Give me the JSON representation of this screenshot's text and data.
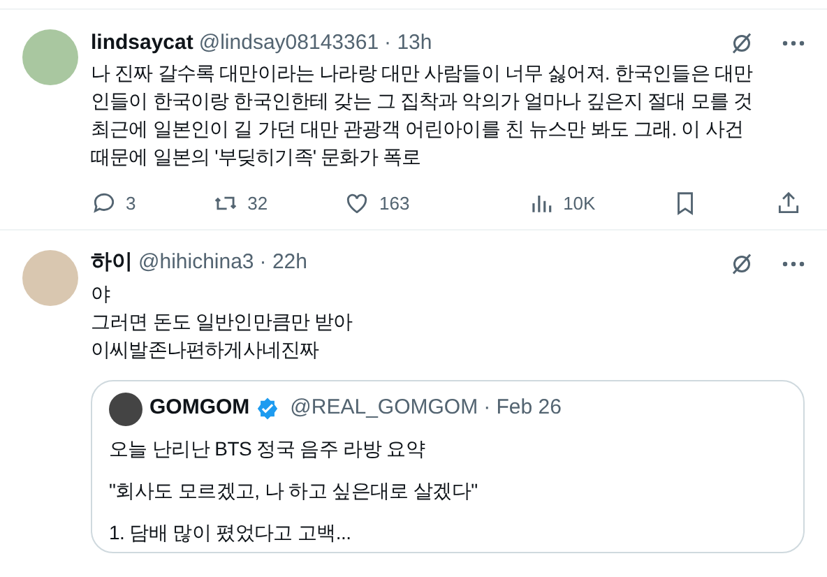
{
  "posts": [
    {
      "display_name": "lindsaycat",
      "handle": "@lindsay08143361",
      "time": "· 13h",
      "text": "나 진짜 갈수록 대만이라는 나라랑 대만 사람들이 너무 싫어져. 한국인들은 대만\n인들이 한국이랑 한국인한테 갖는 그 집착과 악의가 얼마나 깊은지 절대 모를 것\n최근에 일본인이 길 가던 대만 관광객 어린아이를 친 뉴스만 봐도 그래. 이 사건\n때문에 일본의 '부딪히기족' 문화가 폭로",
      "actions": [
        {
          "kind": "reply",
          "count": "3"
        },
        {
          "kind": "repost",
          "count": "32"
        },
        {
          "kind": "like",
          "count": "163"
        },
        {
          "kind": "views",
          "count": "10K"
        },
        {
          "kind": "bookmark"
        },
        {
          "kind": "share"
        }
      ]
    },
    {
      "display_name": "하이",
      "handle": "@hihichina3",
      "time": "· 22h",
      "text": "야\n그러면 돈도 일반인만큼만 받아\n이씨발존나편하게사네진짜",
      "quote": {
        "display_name": "GOMGOM",
        "verified": true,
        "handle": "@REAL_GOMGOM",
        "time": "· Feb 26",
        "paragraphs": [
          "오늘 난리난 BTS 정국 음주 라방 요약",
          "\"회사도 모르겠고, 나 하고 싶은대로 살겠다\"",
          "1. 담배 많이 폈었다고 고백..."
        ]
      }
    }
  ]
}
